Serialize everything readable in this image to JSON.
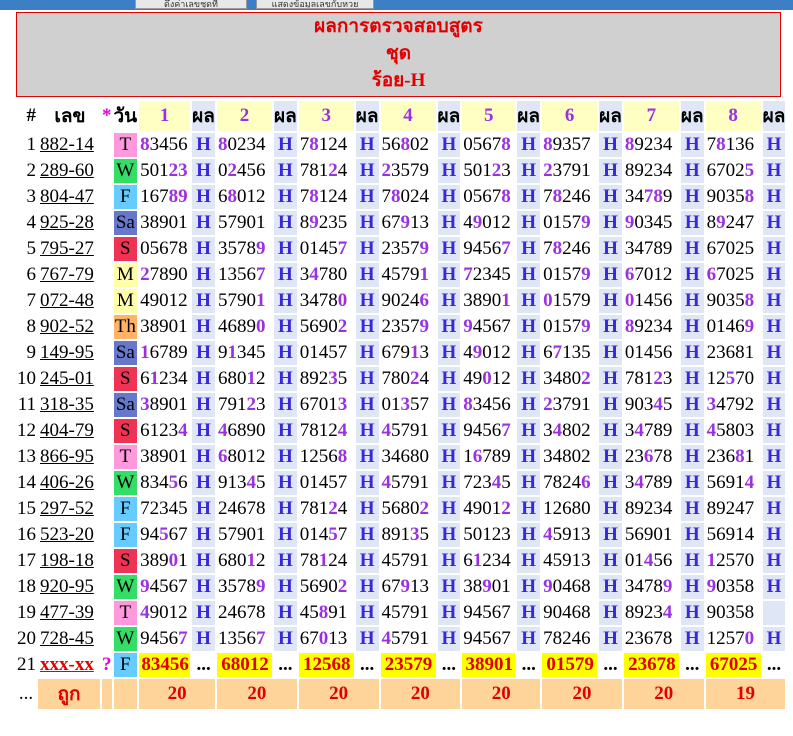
{
  "header": {
    "line1": "ผลการตรวจสอบสูตร",
    "line2": "ชุด",
    "line3": "ร้อย-H"
  },
  "topbar": {
    "btn1": "ดึงค่าเลขชุดที่",
    "btn2": "แสดงข้อมูลเลขกับหวย"
  },
  "columns": {
    "idx": "#",
    "num": "เลข",
    "star": "*",
    "day": "วัน",
    "res": "ผล",
    "sets": [
      "1",
      "2",
      "3",
      "4",
      "5",
      "6",
      "7",
      "8"
    ]
  },
  "day_colors": {
    "T": "#ff99dd",
    "W": "#33dd66",
    "F": "#66ccff",
    "Sa": "#6677cc",
    "S": "#ee3355",
    "M": "#ffffaa",
    "Th": "#ffb366"
  },
  "rows": [
    {
      "idx": "1",
      "num": "882-14",
      "day": "T",
      "vals": [
        "83456",
        "80234",
        "78124",
        "56802",
        "05678",
        "89357",
        "89234",
        "78136"
      ],
      "hl": [
        [
          0
        ],
        [
          0
        ],
        [
          1
        ],
        [
          2
        ],
        [
          4
        ],
        [
          0
        ],
        [
          0
        ],
        [
          1
        ]
      ],
      "res": [
        "H",
        "H",
        "H",
        "H",
        "H",
        "H",
        "H",
        "H"
      ]
    },
    {
      "idx": "2",
      "num": "289-60",
      "day": "W",
      "vals": [
        "50123",
        "02456",
        "78124",
        "23579",
        "50123",
        "23791",
        "89234",
        "67025"
      ],
      "hl": [
        [
          3,
          4
        ],
        [
          1
        ],
        [
          3
        ],
        [
          0
        ],
        [
          3
        ],
        [
          0
        ],
        [],
        [
          4
        ]
      ],
      "res": [
        "H",
        "H",
        "H",
        "H",
        "H",
        "H",
        "H",
        "H"
      ]
    },
    {
      "idx": "3",
      "num": "804-47",
      "day": "F",
      "vals": [
        "16789",
        "68012",
        "78124",
        "78024",
        "05678",
        "78246",
        "34789",
        "90358"
      ],
      "hl": [
        [
          3,
          4
        ],
        [
          1
        ],
        [
          1
        ],
        [
          1
        ],
        [
          4
        ],
        [
          1
        ],
        [
          2,
          3
        ],
        [
          4
        ]
      ],
      "res": [
        "H",
        "H",
        "H",
        "H",
        "H",
        "H",
        "H",
        "H"
      ]
    },
    {
      "idx": "4",
      "num": "925-28",
      "day": "Sa",
      "vals": [
        "38901",
        "57901",
        "89235",
        "67913",
        "49012",
        "01579",
        "90345",
        "89247"
      ],
      "hl": [
        [],
        [],
        [
          1
        ],
        [
          2
        ],
        [
          1
        ],
        [
          4
        ],
        [
          0
        ],
        [
          1
        ]
      ],
      "res": [
        "H",
        "H",
        "H",
        "H",
        "H",
        "H",
        "H",
        "H"
      ]
    },
    {
      "idx": "5",
      "num": "795-27",
      "day": "S",
      "vals": [
        "05678",
        "35789",
        "01457",
        "23579",
        "94567",
        "78246",
        "34789",
        "67025"
      ],
      "hl": [
        [],
        [
          4
        ],
        [
          4
        ],
        [
          4
        ],
        [
          4
        ],
        [
          1
        ],
        [],
        []
      ],
      "res": [
        "H",
        "H",
        "H",
        "H",
        "H",
        "H",
        "H",
        "H"
      ]
    },
    {
      "idx": "6",
      "num": "767-79",
      "day": "M",
      "vals": [
        "27890",
        "13567",
        "34780",
        "45791",
        "72345",
        "01579",
        "67012",
        "67025"
      ],
      "hl": [
        [
          0
        ],
        [
          4
        ],
        [
          1
        ],
        [
          4
        ],
        [
          0
        ],
        [
          4
        ],
        [
          0
        ],
        [
          0
        ]
      ],
      "res": [
        "H",
        "H",
        "H",
        "H",
        "H",
        "H",
        "H",
        "H"
      ]
    },
    {
      "idx": "7",
      "num": "072-48",
      "day": "M",
      "vals": [
        "49012",
        "57901",
        "34780",
        "90246",
        "38901",
        "01579",
        "01456",
        "90358"
      ],
      "hl": [
        [],
        [
          4
        ],
        [
          4
        ],
        [
          4
        ],
        [
          4
        ],
        [
          0
        ],
        [
          0
        ],
        [
          4
        ]
      ],
      "res": [
        "H",
        "H",
        "H",
        "H",
        "H",
        "H",
        "H",
        "H"
      ]
    },
    {
      "idx": "8",
      "num": "902-52",
      "day": "Th",
      "vals": [
        "38901",
        "46890",
        "56902",
        "23579",
        "94567",
        "01579",
        "89234",
        "01469"
      ],
      "hl": [
        [],
        [
          4
        ],
        [
          4
        ],
        [
          4
        ],
        [
          0
        ],
        [
          4
        ],
        [
          0
        ],
        [
          4
        ]
      ],
      "res": [
        "H",
        "H",
        "H",
        "H",
        "H",
        "H",
        "H",
        "H"
      ]
    },
    {
      "idx": "9",
      "num": "149-95",
      "day": "Sa",
      "vals": [
        "16789",
        "91345",
        "01457",
        "67913",
        "49012",
        "67135",
        "01456",
        "23681"
      ],
      "hl": [
        [
          0
        ],
        [
          1
        ],
        [],
        [
          3
        ],
        [
          1
        ],
        [
          1
        ],
        [],
        []
      ],
      "res": [
        "H",
        "H",
        "H",
        "H",
        "H",
        "H",
        "H",
        "H"
      ]
    },
    {
      "idx": "10",
      "num": "245-01",
      "day": "S",
      "vals": [
        "61234",
        "68012",
        "89235",
        "78024",
        "49012",
        "34802",
        "78123",
        "12570"
      ],
      "hl": [
        [
          1
        ],
        [
          3
        ],
        [
          3
        ],
        [
          3
        ],
        [
          2
        ],
        [
          4
        ],
        [
          3
        ],
        [
          2
        ]
      ],
      "res": [
        "H",
        "H",
        "H",
        "H",
        "H",
        "H",
        "H",
        "H"
      ]
    },
    {
      "idx": "11",
      "num": "318-35",
      "day": "Sa",
      "vals": [
        "38901",
        "79123",
        "67013",
        "01357",
        "83456",
        "23791",
        "90345",
        "34792"
      ],
      "hl": [
        [
          0
        ],
        [
          3
        ],
        [
          4
        ],
        [
          2
        ],
        [
          0
        ],
        [
          0
        ],
        [
          3
        ],
        [
          0
        ]
      ],
      "res": [
        "H",
        "H",
        "H",
        "H",
        "H",
        "H",
        "H",
        "H"
      ]
    },
    {
      "idx": "12",
      "num": "404-79",
      "day": "S",
      "vals": [
        "61234",
        "46890",
        "78124",
        "45791",
        "94567",
        "34802",
        "34789",
        "45803"
      ],
      "hl": [
        [
          4
        ],
        [
          0
        ],
        [
          4
        ],
        [
          0
        ],
        [
          4
        ],
        [
          1
        ],
        [
          1
        ],
        [
          0
        ]
      ],
      "res": [
        "H",
        "H",
        "H",
        "H",
        "H",
        "H",
        "H",
        "H"
      ]
    },
    {
      "idx": "13",
      "num": "866-95",
      "day": "T",
      "vals": [
        "38901",
        "68012",
        "12568",
        "34680",
        "16789",
        "34802",
        "23678",
        "23681"
      ],
      "hl": [
        [],
        [
          0
        ],
        [
          4
        ],
        [],
        [
          1
        ],
        [],
        [
          2
        ],
        [
          3
        ]
      ],
      "res": [
        "H",
        "H",
        "H",
        "H",
        "H",
        "H",
        "H",
        "H"
      ]
    },
    {
      "idx": "14",
      "num": "406-26",
      "day": "W",
      "vals": [
        "83456",
        "91345",
        "01457",
        "45791",
        "72345",
        "78246",
        "34789",
        "56914"
      ],
      "hl": [
        [
          3
        ],
        [
          3
        ],
        [],
        [
          0
        ],
        [
          3
        ],
        [
          4
        ],
        [
          1
        ],
        [
          4
        ]
      ],
      "res": [
        "H",
        "H",
        "H",
        "H",
        "H",
        "H",
        "H",
        "H"
      ]
    },
    {
      "idx": "15",
      "num": "297-52",
      "day": "F",
      "vals": [
        "72345",
        "24678",
        "78124",
        "56802",
        "49012",
        "12680",
        "89234",
        "89247"
      ],
      "hl": [
        [],
        [],
        [
          3
        ],
        [
          4
        ],
        [
          4
        ],
        [],
        [],
        []
      ],
      "res": [
        "H",
        "H",
        "H",
        "H",
        "H",
        "H",
        "H",
        "H"
      ]
    },
    {
      "idx": "16",
      "num": "523-20",
      "day": "F",
      "vals": [
        "94567",
        "57901",
        "01457",
        "89135",
        "50123",
        "45913",
        "56901",
        "56914"
      ],
      "hl": [
        [
          2
        ],
        [],
        [
          3
        ],
        [
          3
        ],
        [],
        [
          0
        ],
        [],
        []
      ],
      "res": [
        "H",
        "H",
        "H",
        "H",
        "H",
        "H",
        "H",
        "H"
      ]
    },
    {
      "idx": "17",
      "num": "198-18",
      "day": "S",
      "vals": [
        "38901",
        "68012",
        "78124",
        "45791",
        "61234",
        "45913",
        "01456",
        "12570"
      ],
      "hl": [
        [
          3
        ],
        [
          3
        ],
        [
          2
        ],
        [],
        [
          1
        ],
        [],
        [
          2
        ],
        [
          0
        ]
      ],
      "res": [
        "H",
        "H",
        "H",
        "H",
        "H",
        "H",
        "H",
        "H"
      ]
    },
    {
      "idx": "18",
      "num": "920-95",
      "day": "W",
      "vals": [
        "94567",
        "35789",
        "56902",
        "67913",
        "38901",
        "90468",
        "34789",
        "90358"
      ],
      "hl": [
        [
          0
        ],
        [
          4
        ],
        [
          4
        ],
        [
          2
        ],
        [
          2
        ],
        [
          0
        ],
        [
          4
        ],
        [
          0
        ]
      ],
      "res": [
        "H",
        "H",
        "H",
        "H",
        "H",
        "H",
        "H",
        "H"
      ]
    },
    {
      "idx": "19",
      "num": "477-39",
      "day": "T",
      "vals": [
        "49012",
        "24678",
        "45891",
        "45791",
        "94567",
        "90468",
        "89234",
        "90358"
      ],
      "hl": [
        [
          0
        ],
        [],
        [
          2
        ],
        [],
        [],
        [],
        [
          4
        ],
        []
      ],
      "res": [
        "H",
        "H",
        "H",
        "H",
        "H",
        "H",
        "H",
        ""
      ]
    },
    {
      "idx": "20",
      "num": "728-45",
      "day": "W",
      "vals": [
        "94567",
        "13567",
        "67013",
        "45791",
        "94567",
        "78246",
        "23678",
        "12570"
      ],
      "hl": [
        [
          4
        ],
        [
          4
        ],
        [
          2
        ],
        [
          0
        ],
        [],
        [],
        [],
        [
          4
        ]
      ],
      "res": [
        "H",
        "H",
        "H",
        "H",
        "H",
        "H",
        "H",
        "H"
      ]
    }
  ],
  "row21": {
    "idx": "21",
    "num": "xxx-xx",
    "q": "?",
    "day": "F",
    "vals": [
      "83456",
      "68012",
      "12568",
      "23579",
      "38901",
      "01579",
      "23678",
      "67025"
    ],
    "res": [
      "...",
      "...",
      "...",
      "...",
      "...",
      "...",
      "...",
      "..."
    ]
  },
  "footer": {
    "idx": "...",
    "label": "ถูก",
    "counts": [
      "20",
      "20",
      "20",
      "20",
      "20",
      "20",
      "20",
      "19"
    ]
  }
}
